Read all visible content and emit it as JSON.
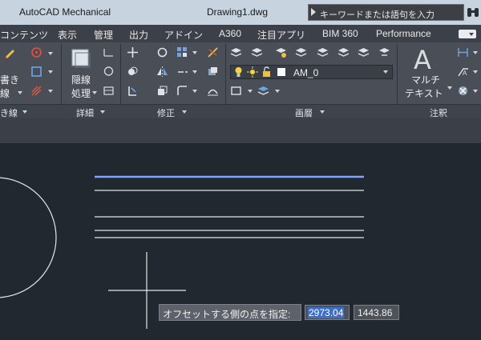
{
  "title_bar": {
    "app_name": "AutoCAD Mechanical",
    "document": "Drawing1.dwg",
    "search_placeholder": "キーワードまたは語句を入力"
  },
  "menu_tabs": [
    "コンテンツ",
    "表示",
    "管理",
    "出力",
    "アドイン",
    "A360",
    "注目アプリ",
    "BIM 360",
    "Performance"
  ],
  "ribbon": {
    "panels": [
      {
        "label": "き線"
      },
      {
        "label": "詳細"
      },
      {
        "label": "修正"
      },
      {
        "label": "画層"
      },
      {
        "label": "注釈"
      }
    ],
    "draw_panel": {
      "button_line1": "書き",
      "button_line2": "線"
    },
    "detail_panel": {
      "button_line1": "隠線",
      "button_line2": "処理"
    },
    "layer_panel": {
      "current_layer": "AM_0"
    },
    "annotation_panel": {
      "big_icon": "A",
      "button_line1": "マルチ",
      "button_line2": "テキスト"
    }
  },
  "command_prompt": {
    "text": "オフセットする側の点を指定:",
    "value_1": "2973.04",
    "value_2": "1443.86"
  },
  "colors": {
    "canvas_background": "#212830",
    "ribbon_background": "#4a4f57",
    "highlight_line": "#7ea6ff",
    "selection": "#3d6fc9"
  }
}
